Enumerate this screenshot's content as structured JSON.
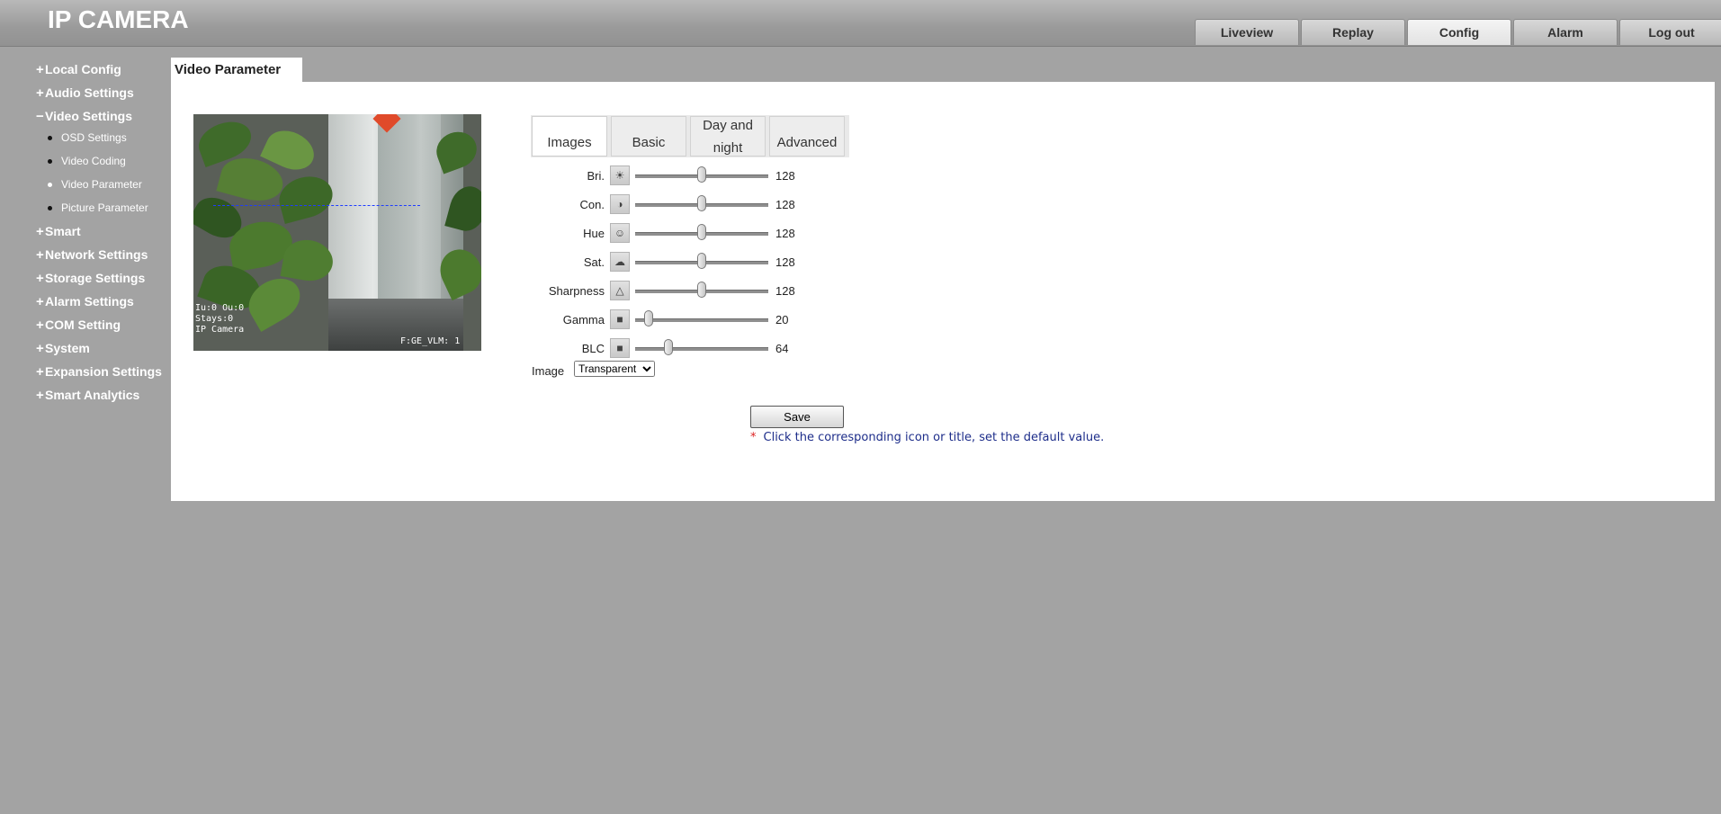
{
  "header": {
    "title": "IP CAMERA",
    "tabs": [
      {
        "label": "Liveview",
        "active": false
      },
      {
        "label": "Replay",
        "active": false
      },
      {
        "label": "Config",
        "active": true
      },
      {
        "label": "Alarm",
        "active": false
      },
      {
        "label": "Log out",
        "active": false
      }
    ]
  },
  "sidebar": {
    "groups": [
      {
        "label": "Local Config",
        "expanded": false
      },
      {
        "label": "Audio Settings",
        "expanded": false
      },
      {
        "label": "Video Settings",
        "expanded": true,
        "items": [
          {
            "label": "OSD Settings",
            "active": false
          },
          {
            "label": "Video Coding",
            "active": false
          },
          {
            "label": "Video Parameter",
            "active": true
          },
          {
            "label": "Picture Parameter",
            "active": false
          }
        ]
      },
      {
        "label": "Smart",
        "expanded": false
      },
      {
        "label": "Network Settings",
        "expanded": false
      },
      {
        "label": "Storage Settings",
        "expanded": false
      },
      {
        "label": "Alarm Settings",
        "expanded": false
      },
      {
        "label": "COM Setting",
        "expanded": false
      },
      {
        "label": "System",
        "expanded": false
      },
      {
        "label": "Expansion Settings",
        "expanded": false
      },
      {
        "label": "Smart Analytics",
        "expanded": false
      }
    ],
    "plus_symbol": "+",
    "minus_symbol": "−"
  },
  "page": {
    "title": "Video Parameter",
    "preview": {
      "osd_lines": "Iu:0 Ou:0\nStays:0\nIP Camera",
      "osd_right": "F:GE_VLM: 1"
    },
    "subtabs": [
      {
        "label": "Images",
        "active": true
      },
      {
        "label": "Basic",
        "active": false
      },
      {
        "label": "Day and night",
        "active": false
      },
      {
        "label": "Advanced",
        "active": false
      }
    ],
    "params": [
      {
        "label": "Bri.",
        "icon": "brightness-icon",
        "value": 128,
        "min": 0,
        "max": 255
      },
      {
        "label": "Con.",
        "icon": "contrast-icon",
        "value": 128,
        "min": 0,
        "max": 255
      },
      {
        "label": "Hue",
        "icon": "hue-icon",
        "value": 128,
        "min": 0,
        "max": 255
      },
      {
        "label": "Sat.",
        "icon": "saturation-icon",
        "value": 128,
        "min": 0,
        "max": 255
      },
      {
        "label": "Sharpness",
        "icon": "sharpness-icon",
        "value": 128,
        "min": 0,
        "max": 255
      },
      {
        "label": "Gamma",
        "icon": "gamma-icon",
        "value": 20,
        "min": 0,
        "max": 200
      },
      {
        "label": "BLC",
        "icon": "blc-icon",
        "value": 64,
        "min": 0,
        "max": 255
      }
    ],
    "image_label": "Image",
    "image_select": {
      "value": "Transparent",
      "options": [
        "Transparent"
      ]
    },
    "save_label": "Save",
    "note_star": "*",
    "note": "Click the corresponding icon or title, set the default value."
  },
  "colors": {
    "background": "#a3a3a3",
    "panel": "#ffffff",
    "note_text": "#1d2d8a",
    "star": "#dd2222"
  }
}
